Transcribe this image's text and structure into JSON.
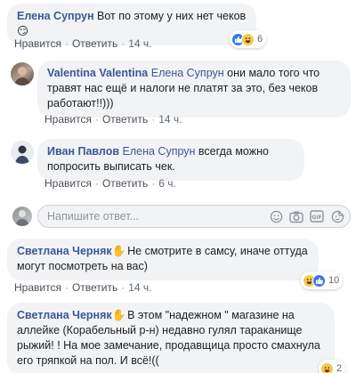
{
  "comments": [
    {
      "author": "Елена Супрун",
      "text": " Вот по этому у них нет чеков ",
      "emoji": "😏",
      "like_label": "Нравится",
      "reply_label": "Ответить",
      "time": "14 ч.",
      "reaction_count": "6"
    },
    {
      "author": "Valentina Valentina",
      "mention": "Елена Супрун",
      "text": " они мало того что травят нас ещё и налоги не платят за это, без чеков работают!!)))",
      "like_label": "Нравится",
      "reply_label": "Ответить",
      "time": "14 ч."
    },
    {
      "author": "Иван Павлов",
      "mention": "Елена Супрун",
      "text": " всегда можно попросить выписать чек.",
      "like_label": "Нравится",
      "reply_label": "Ответить",
      "time": "6 ч."
    },
    {
      "author": "Светлана Черняк",
      "text": " Не смотрите в самсу, иначе оттуда могут посмотреть на вас)",
      "like_label": "Нравится",
      "reply_label": "Ответить",
      "time": "14 ч.",
      "reaction_count": "10"
    },
    {
      "author": "Светлана Черняк",
      "text": " В этом \"надежном \" магазине на аллейке (Корабельный р-н) недавно гулял тараканище рыжий! ! На мое замечание, продавщица просто смахнула его тряпкой на пол. И всё!((",
      "reaction_count": "2"
    }
  ],
  "composer": {
    "placeholder": "Напишите ответ...",
    "icons": [
      "emoji-icon",
      "camera-icon",
      "gif-icon",
      "sticker-icon"
    ]
  },
  "colors": {
    "author": "#385898",
    "bubble": "#f2f3f5",
    "like_blue": "#3578e5",
    "haha_yellow": "#f7c84a"
  }
}
